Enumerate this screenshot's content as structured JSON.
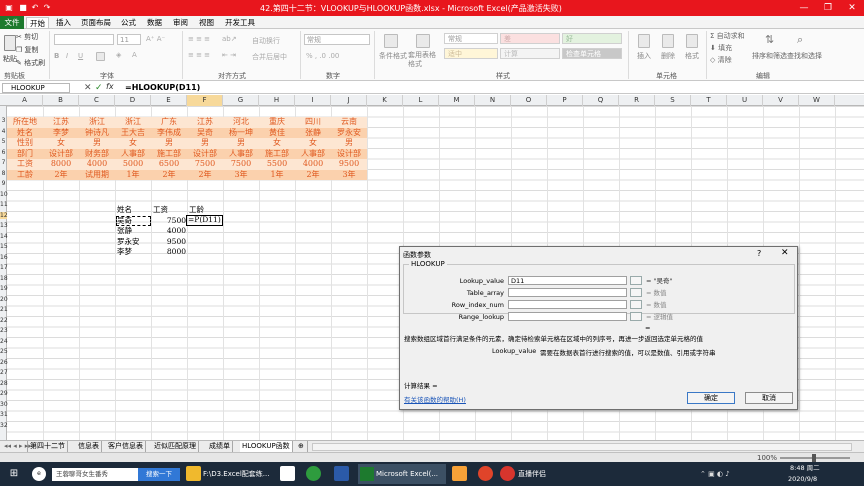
{
  "window": {
    "title": "42.第四十二节：VLOOKUP与HLOOKUP函数.xlsx - Microsoft Excel(产品激活失败)"
  },
  "tabs": [
    {
      "label": "文件"
    },
    {
      "label": "开始"
    },
    {
      "label": "插入"
    },
    {
      "label": "页面布局"
    },
    {
      "label": "公式"
    },
    {
      "label": "数据"
    },
    {
      "label": "审阅"
    },
    {
      "label": "视图"
    },
    {
      "label": "开发工具"
    }
  ],
  "ribbon": {
    "clipboard": {
      "cut": "剪切",
      "copy": "复制",
      "painter": "格式刷",
      "paste": "粘贴",
      "label": "剪贴板"
    },
    "font": {
      "size": "11",
      "label": "字体"
    },
    "align": {
      "wrap": "自动换行",
      "merge": "合并后居中",
      "label": "对齐方式"
    },
    "number": {
      "format": "常规",
      "label": "数字"
    },
    "styles": {
      "cond": "条件格式",
      "table": "套用表格格式",
      "cells": [
        "常规",
        "差",
        "好",
        "适中",
        "计算",
        "检查单元格"
      ],
      "label": "样式"
    },
    "cells": {
      "insert": "插入",
      "delete": "删除",
      "format": "格式",
      "label": "单元格"
    },
    "edit": {
      "autosum": "自动求和",
      "fill": "填充",
      "clear": "清除",
      "sort": "排序和筛选",
      "find": "查找和选择",
      "label": "编辑"
    }
  },
  "formula": {
    "name": "HLOOKUP",
    "fx": "fx",
    "text": "=HLOOKUP(D11)"
  },
  "columns": [
    "A",
    "B",
    "C",
    "D",
    "E",
    "F",
    "G",
    "H",
    "I",
    "J",
    "K",
    "L",
    "M",
    "N",
    "O",
    "P",
    "Q",
    "R",
    "S",
    "T",
    "U",
    "V",
    "W"
  ],
  "rows": [
    "3",
    "4",
    "5",
    "6",
    "7",
    "8",
    "9",
    "10",
    "11",
    "12",
    "13",
    "14",
    "15",
    "16",
    "17",
    "18",
    "19",
    "20",
    "21",
    "22",
    "23",
    "24",
    "25",
    "26",
    "27",
    "28",
    "29",
    "30",
    "31",
    "32"
  ],
  "table": [
    [
      "所在地",
      "江苏",
      "浙江",
      "浙江",
      "广东",
      "江苏",
      "河北",
      "重庆",
      "四川",
      "云南"
    ],
    [
      "姓名",
      "李梦",
      "钟诗凡",
      "王大吉",
      "李伟成",
      "吴奇",
      "杨一坤",
      "黄佳",
      "张静",
      "罗永安"
    ],
    [
      "性别",
      "女",
      "男",
      "女",
      "男",
      "男",
      "男",
      "女",
      "女",
      "男"
    ],
    [
      "部门",
      "设计部",
      "财务部",
      "人事部",
      "施工部",
      "设计部",
      "人事部",
      "施工部",
      "人事部",
      "设计部"
    ],
    [
      "工资",
      "8000",
      "4000",
      "5000",
      "6500",
      "7500",
      "7500",
      "5500",
      "4000",
      "9500"
    ],
    [
      "工龄",
      "2年",
      "试用期",
      "1年",
      "2年",
      "2年",
      "3年",
      "1年",
      "2年",
      "3年"
    ]
  ],
  "lookup": {
    "headers": [
      "姓名",
      "工资",
      "工龄"
    ],
    "rows": [
      [
        "吴奇",
        "7500",
        "=P(D11)"
      ],
      [
        "张静",
        "4000",
        ""
      ],
      [
        "罗永安",
        "9500",
        ""
      ],
      [
        "李梦",
        "8000",
        ""
      ]
    ]
  },
  "sheets": [
    "第四十二节",
    "信息表",
    "客户信息表",
    "近似匹配原理",
    "成绩单",
    "HLOOKUP函数"
  ],
  "status": {
    "zoom": "100%"
  },
  "dialog": {
    "title": "函数参数",
    "help": "?",
    "close": "✕",
    "func": "HLOOKUP",
    "args": [
      {
        "name": "Lookup_value",
        "value": "D11",
        "result": "= \"吴奇\""
      },
      {
        "name": "Table_array",
        "value": "",
        "result": "= 数值"
      },
      {
        "name": "Row_index_num",
        "value": "",
        "result": "= 数值"
      },
      {
        "name": "Range_lookup",
        "value": "",
        "result": "= 逻辑值"
      }
    ],
    "eq": "=",
    "desc": "搜索数组区域首行满足条件的元素，确定待检索单元格在区域中的列序号，再进一步返回选定单元格的值",
    "arg_desc_name": "Lookup_value",
    "arg_desc": "需要在数据表首行进行搜索的值，可以是数值、引用或字符串",
    "result_label": "计算结果 =",
    "help_link": "有关该函数的帮助(H)",
    "ok": "确定",
    "cancel": "取消"
  },
  "taskbar": {
    "search": "王蓉聊哥女生番秀",
    "search_btn": "搜索一下",
    "folder": "F:\\D3.Excel配套练...",
    "excel": "Microsoft Excel(...",
    "live": "直播伴侣",
    "time": "8:48 周二",
    "date": "2020/9/8"
  }
}
